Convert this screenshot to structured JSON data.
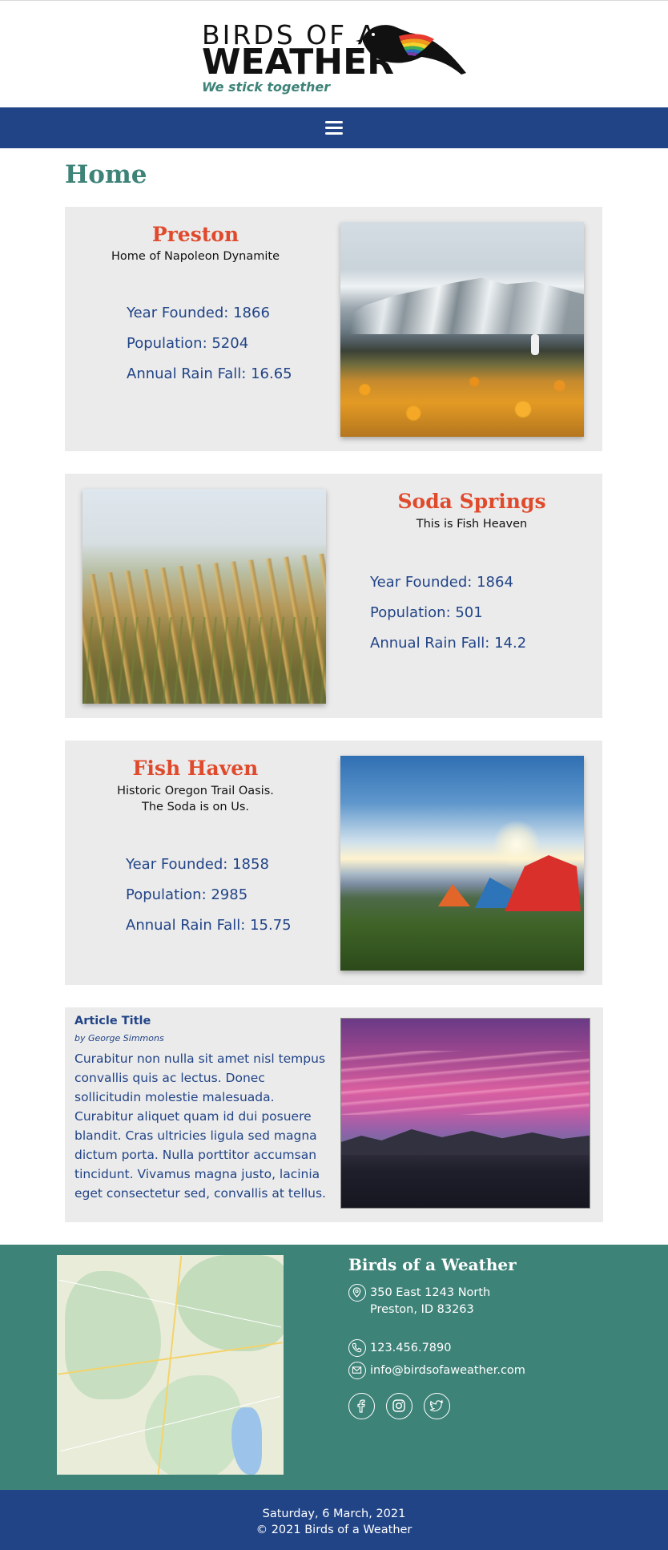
{
  "header": {
    "logo_line1": "BIRDS OF A",
    "logo_line2": "WEATHER",
    "tagline": "We stick together"
  },
  "nav": {
    "menu_icon": "hamburger-menu-icon"
  },
  "page": {
    "title": "Home"
  },
  "towns": [
    {
      "name": "Preston",
      "motto": "Home of Napoleon Dynamite",
      "year_founded": "Year Founded: 1866",
      "population": "Population: 5204",
      "rain": "Annual Rain Fall: 16.65"
    },
    {
      "name": "Soda Springs",
      "motto": "This is Fish Heaven",
      "year_founded": "Year Founded: 1864",
      "population": "Population: 501",
      "rain": "Annual Rain Fall: 14.2"
    },
    {
      "name": "Fish Haven",
      "motto_line1": "Historic Oregon Trail Oasis.",
      "motto_line2": "The Soda is on Us.",
      "year_founded": "Year Founded: 1858",
      "population": "Population: 2985",
      "rain": "Annual Rain Fall: 15.75"
    }
  ],
  "article": {
    "title": "Article Title",
    "byline": "by George Simmons",
    "body": "Curabitur non nulla sit amet nisl tempus convallis quis ac lectus. Donec sollicitudin molestie malesuada. Curabitur aliquet quam id dui posuere blandit. Cras ultricies ligula sed magna dictum porta. Nulla porttitor accumsan tincidunt. Vivamus magna justo, lacinia eget consectetur sed, convallis at tellus."
  },
  "footer": {
    "title": "Birds of a Weather",
    "address_line1": "350 East 1243 North",
    "address_line2": "Preston, ID 83263",
    "phone": "123.456.7890",
    "email": "info@birdsofaweather.com",
    "social": [
      "facebook-icon",
      "instagram-icon",
      "twitter-icon"
    ]
  },
  "copyright": {
    "date": "Saturday, 6 March, 2021",
    "notice": "© 2021 Birds of a Weather"
  },
  "colors": {
    "nav_blue": "#214487",
    "teal": "#3e8378",
    "town_red": "#e04a2c",
    "card_gray": "#ebebeb"
  }
}
